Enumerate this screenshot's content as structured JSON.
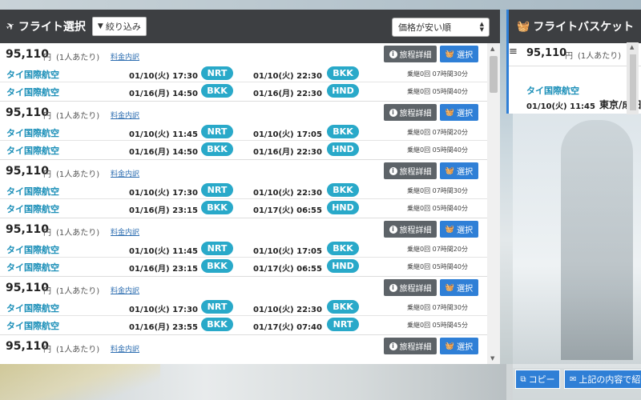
{
  "header": {
    "title": "フライト選択",
    "filter_label": "絞り込み",
    "sort_value": "価格が安い順"
  },
  "flights": [
    {
      "price": "95,110",
      "yen": "円",
      "per": "(1人あたり)",
      "breakdown": "料金内訳",
      "detail_label": "旅程詳細",
      "select_label": "選択",
      "legs": [
        {
          "airline": "タイ国際航空",
          "dep_time": "01/10(火) 17:30",
          "dep": "NRT",
          "arr_time": "01/10(火) 22:30",
          "arr": "BKK",
          "stops": "乗継0回 07時間30分"
        },
        {
          "airline": "タイ国際航空",
          "dep_time": "01/16(月) 14:50",
          "dep": "BKK",
          "arr_time": "01/16(月) 22:30",
          "arr": "HND",
          "stops": "乗継0回 05時間40分"
        }
      ]
    },
    {
      "price": "95,110",
      "yen": "円",
      "per": "(1人あたり)",
      "breakdown": "料金内訳",
      "detail_label": "旅程詳細",
      "select_label": "選択",
      "legs": [
        {
          "airline": "タイ国際航空",
          "dep_time": "01/10(火) 11:45",
          "dep": "NRT",
          "arr_time": "01/10(火) 17:05",
          "arr": "BKK",
          "stops": "乗継0回 07時間20分"
        },
        {
          "airline": "タイ国際航空",
          "dep_time": "01/16(月) 14:50",
          "dep": "BKK",
          "arr_time": "01/16(月) 22:30",
          "arr": "HND",
          "stops": "乗継0回 05時間40分"
        }
      ]
    },
    {
      "price": "95,110",
      "yen": "円",
      "per": "(1人あたり)",
      "breakdown": "料金内訳",
      "detail_label": "旅程詳細",
      "select_label": "選択",
      "legs": [
        {
          "airline": "タイ国際航空",
          "dep_time": "01/10(火) 17:30",
          "dep": "NRT",
          "arr_time": "01/10(火) 22:30",
          "arr": "BKK",
          "stops": "乗継0回 07時間30分"
        },
        {
          "airline": "タイ国際航空",
          "dep_time": "01/16(月) 23:15",
          "dep": "BKK",
          "arr_time": "01/17(火) 06:55",
          "arr": "HND",
          "stops": "乗継0回 05時間40分"
        }
      ]
    },
    {
      "price": "95,110",
      "yen": "円",
      "per": "(1人あたり)",
      "breakdown": "料金内訳",
      "detail_label": "旅程詳細",
      "select_label": "選択",
      "legs": [
        {
          "airline": "タイ国際航空",
          "dep_time": "01/10(火) 11:45",
          "dep": "NRT",
          "arr_time": "01/10(火) 17:05",
          "arr": "BKK",
          "stops": "乗継0回 07時間20分"
        },
        {
          "airline": "タイ国際航空",
          "dep_time": "01/16(月) 23:15",
          "dep": "BKK",
          "arr_time": "01/17(火) 06:55",
          "arr": "HND",
          "stops": "乗継0回 05時間40分"
        }
      ]
    },
    {
      "price": "95,110",
      "yen": "円",
      "per": "(1人あたり)",
      "breakdown": "料金内訳",
      "detail_label": "旅程詳細",
      "select_label": "選択",
      "legs": [
        {
          "airline": "タイ国際航空",
          "dep_time": "01/10(火) 17:30",
          "dep": "NRT",
          "arr_time": "01/10(火) 22:30",
          "arr": "BKK",
          "stops": "乗継0回 07時間30分"
        },
        {
          "airline": "タイ国際航空",
          "dep_time": "01/16(月) 23:55",
          "dep": "BKK",
          "arr_time": "01/17(火) 07:40",
          "arr": "NRT",
          "stops": "乗継0回 05時間45分"
        }
      ]
    },
    {
      "price": "95,110",
      "yen": "円",
      "per": "(1人あたり)",
      "breakdown": "料金内訳",
      "detail_label": "旅程詳細",
      "select_label": "選択",
      "legs": []
    }
  ],
  "basket": {
    "title": "フライトバスケット",
    "price": "95,110",
    "yen": "円",
    "per": "(1人あたり)",
    "close": "✕",
    "airline": "タイ国際航空",
    "date": "01/10(火) 11:45",
    "route": "東京/成田",
    "copy_label": "コピー",
    "confirm_label": "上記の内容で紹介"
  },
  "colors": {
    "header_bg": "#3d3f42",
    "airport_badge": "#29a9c9",
    "airline_text": "#1b8fb8",
    "primary_button": "#2f7fd6",
    "detail_button": "#5d6368"
  }
}
